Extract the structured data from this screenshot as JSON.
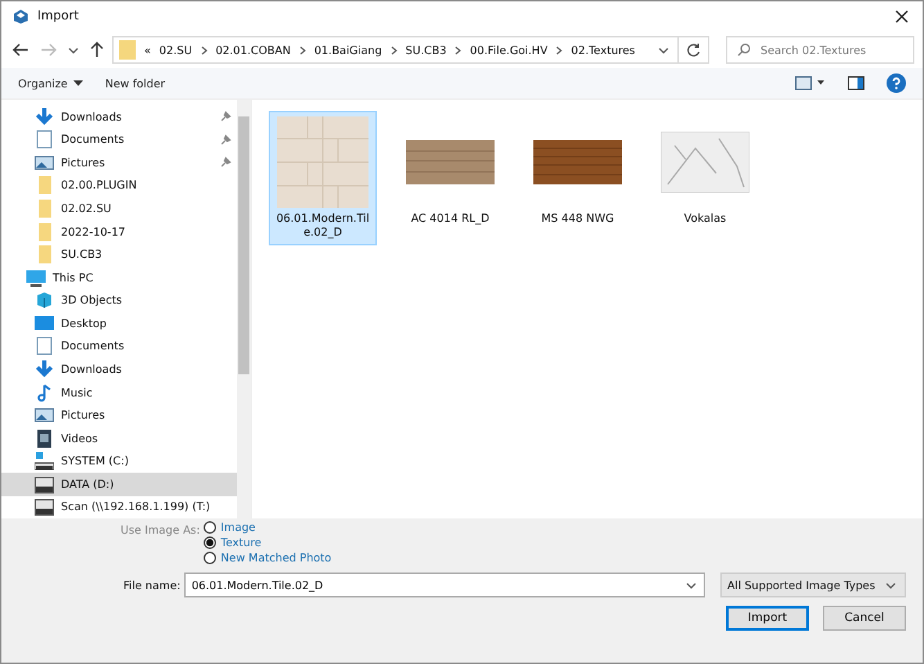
{
  "window": {
    "title": "Import"
  },
  "address_bar": {
    "overflow": "«",
    "path": [
      "02.SU",
      "02.01.COBAN",
      "01.BaiGiang",
      "SU.CB3",
      "00.File.Goi.HV",
      "02.Textures"
    ]
  },
  "search": {
    "placeholder": "Search 02.Textures"
  },
  "toolbar": {
    "buttons": [
      "Organize",
      "New folder"
    ]
  },
  "sidebar": {
    "items": [
      {
        "label": "Downloads",
        "kind": "download",
        "pinned": true,
        "selected": false
      },
      {
        "label": "Documents",
        "kind": "document",
        "pinned": true,
        "selected": false
      },
      {
        "label": "Pictures",
        "kind": "picture",
        "pinned": true,
        "selected": false
      },
      {
        "label": "02.00.PLUGIN",
        "kind": "folder",
        "pinned": false,
        "selected": false
      },
      {
        "label": "02.02.SU",
        "kind": "folder",
        "pinned": false,
        "selected": false
      },
      {
        "label": "2022-10-17",
        "kind": "folder",
        "pinned": false,
        "selected": false
      },
      {
        "label": "SU.CB3",
        "kind": "folder",
        "pinned": false,
        "selected": false
      },
      {
        "label": "This PC",
        "kind": "pc",
        "selected": false,
        "children": [
          {
            "label": "3D Objects",
            "kind": "cube",
            "selected": false
          },
          {
            "label": "Desktop",
            "kind": "desktop",
            "selected": false
          },
          {
            "label": "Documents",
            "kind": "document",
            "selected": false
          },
          {
            "label": "Downloads",
            "kind": "download",
            "selected": false
          },
          {
            "label": "Music",
            "kind": "music",
            "selected": false
          },
          {
            "label": "Pictures",
            "kind": "picture",
            "selected": false
          },
          {
            "label": "Videos",
            "kind": "video",
            "selected": false
          },
          {
            "label": "SYSTEM (C:)",
            "kind": "system-drive",
            "selected": false
          },
          {
            "label": "DATA (D:)",
            "kind": "drive",
            "selected": true
          },
          {
            "label": "Scan (\\\\192.168.1.199) (T:)",
            "kind": "drive",
            "selected": false
          }
        ]
      }
    ]
  },
  "files": [
    {
      "name": "06.01.Modern.Tile.02_D",
      "kind": "tile",
      "selected": true
    },
    {
      "name": "AC 4014 RL_D",
      "kind": "wood-light",
      "selected": false
    },
    {
      "name": "MS 448 NWG",
      "kind": "wood-dark",
      "selected": false
    },
    {
      "name": "Vokalas",
      "kind": "marble",
      "selected": false
    }
  ],
  "use_image_as": {
    "label": "Use Image As:",
    "options": [
      {
        "label": "Image",
        "selected": false
      },
      {
        "label": "Texture",
        "selected": true
      },
      {
        "label": "New Matched Photo",
        "selected": false
      }
    ]
  },
  "file_name": {
    "label": "File name:",
    "value": "06.01.Modern.Tile.02_D"
  },
  "file_type": {
    "value": "All Supported Image Types"
  },
  "buttons": [
    "Import",
    "Cancel"
  ]
}
